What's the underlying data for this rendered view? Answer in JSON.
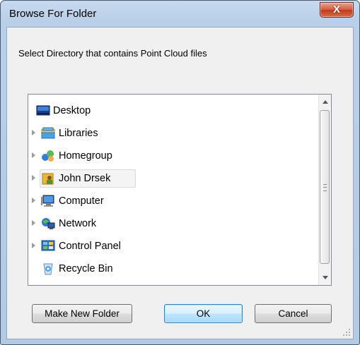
{
  "window": {
    "title": "Browse For Folder",
    "close_glyph": "X"
  },
  "prompt": "Select Directory that contains Point Cloud files",
  "tree": {
    "items": [
      {
        "label": "Desktop",
        "icon": "desktop-icon",
        "expandable": false
      },
      {
        "label": "Libraries",
        "icon": "libraries-icon",
        "expandable": true
      },
      {
        "label": "Homegroup",
        "icon": "homegroup-icon",
        "expandable": true
      },
      {
        "label": "John Drsek",
        "icon": "user-folder-icon",
        "expandable": true,
        "highlighted": true
      },
      {
        "label": "Computer",
        "icon": "computer-icon",
        "expandable": true
      },
      {
        "label": "Network",
        "icon": "network-icon",
        "expandable": true
      },
      {
        "label": "Control Panel",
        "icon": "control-panel-icon",
        "expandable": true
      },
      {
        "label": "Recycle Bin",
        "icon": "recycle-bin-icon",
        "expandable": false
      }
    ]
  },
  "buttons": {
    "make_new_folder": "Make New Folder",
    "ok": "OK",
    "cancel": "Cancel"
  },
  "colors": {
    "frame": "#b9cfe8",
    "close_button": "#c8472a",
    "default_button_border": "#3c7fb1"
  }
}
